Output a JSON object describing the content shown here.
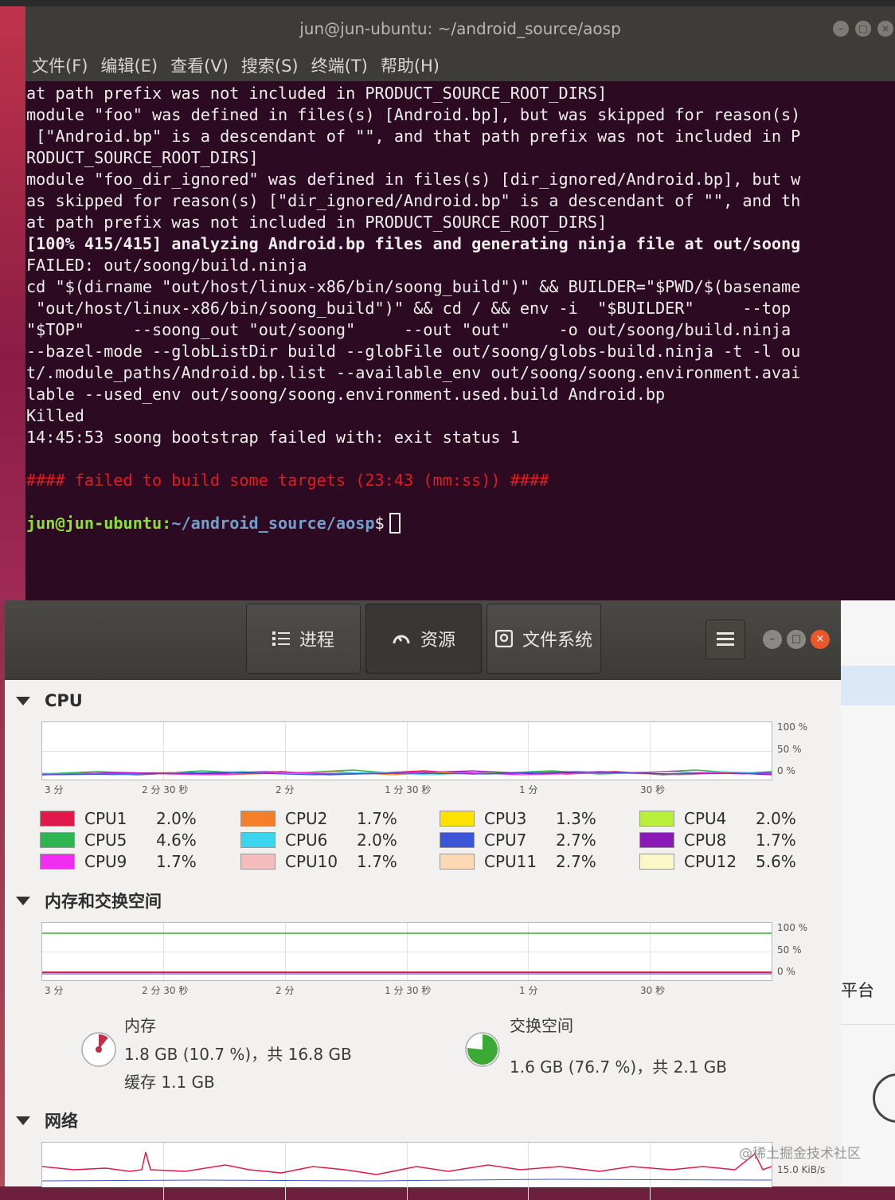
{
  "terminal": {
    "title": "jun@jun-ubuntu: ~/android_source/aosp",
    "menu": [
      "文件(F)",
      "编辑(E)",
      "查看(V)",
      "搜索(S)",
      "终端(T)",
      "帮助(H)"
    ],
    "lines": [
      "at path prefix was not included in PRODUCT_SOURCE_ROOT_DIRS]",
      "module \"foo\" was defined in files(s) [Android.bp], but was skipped for reason(s)",
      " [\"Android.bp\" is a descendant of \"\", and that path prefix was not included in P",
      "RODUCT_SOURCE_ROOT_DIRS]",
      "module \"foo_dir_ignored\" was defined in files(s) [dir_ignored/Android.bp], but w",
      "as skipped for reason(s) [\"dir_ignored/Android.bp\" is a descendant of \"\", and th",
      "at path prefix was not included in PRODUCT_SOURCE_ROOT_DIRS]",
      "[100% 415/415] analyzing Android.bp files and generating ninja file at out/soong",
      "FAILED: out/soong/build.ninja",
      "cd \"$(dirname \"out/host/linux-x86/bin/soong_build\")\" && BUILDER=\"$PWD/$(basename",
      " \"out/host/linux-x86/bin/soong_build\")\" && cd / && env -i  \"$BUILDER\"     --top",
      "\"$TOP\"     --soong_out \"out/soong\"     --out \"out\"     -o out/soong/build.ninja",
      "--bazel-mode --globListDir build --globFile out/soong/globs-build.ninja -t -l ou",
      "t/.module_paths/Android.bp.list --available_env out/soong/soong.environment.avai",
      "lable --used_env out/soong/soong.environment.used.build Android.bp",
      "Killed",
      "14:45:53 soong bootstrap failed with: exit status 1",
      "",
      "#### failed to build some targets (23:43 (mm:ss)) ####",
      ""
    ],
    "prompt_user": "jun@jun-ubuntu",
    "prompt_sep": ":",
    "prompt_path": "~/android_source/aosp",
    "prompt_symbol": "$"
  },
  "monitor": {
    "tabs": [
      {
        "label": "进程",
        "icon": "list-icon"
      },
      {
        "label": "资源",
        "icon": "gauge-icon"
      },
      {
        "label": "文件系统",
        "icon": "disk-icon"
      }
    ],
    "cpu_title": "CPU",
    "mem_title": "内存和交换空间",
    "net_title": "网络",
    "y_labels": [
      "100 %",
      "50 %",
      "0 %"
    ],
    "x_labels": [
      "3 分",
      "2 分 30 秒",
      "2 分",
      "1 分 30 秒",
      "1 分",
      "30 秒"
    ],
    "cpus": [
      {
        "name": "CPU1",
        "value": "2.0%",
        "color": "#e0194a"
      },
      {
        "name": "CPU2",
        "value": "1.7%",
        "color": "#f57e2a"
      },
      {
        "name": "CPU3",
        "value": "1.3%",
        "color": "#fce200"
      },
      {
        "name": "CPU4",
        "value": "2.0%",
        "color": "#b8f03c"
      },
      {
        "name": "CPU5",
        "value": "4.6%",
        "color": "#2db64f"
      },
      {
        "name": "CPU6",
        "value": "2.0%",
        "color": "#3cd5f0"
      },
      {
        "name": "CPU7",
        "value": "2.7%",
        "color": "#3a55d6"
      },
      {
        "name": "CPU8",
        "value": "1.7%",
        "color": "#8a1ab6"
      },
      {
        "name": "CPU9",
        "value": "1.7%",
        "color": "#f02ef0"
      },
      {
        "name": "CPU10",
        "value": "1.7%",
        "color": "#f5bcbc"
      },
      {
        "name": "CPU11",
        "value": "2.7%",
        "color": "#fcd8b4"
      },
      {
        "name": "CPU12",
        "value": "5.6%",
        "color": "#fbf8c8"
      }
    ],
    "memory": {
      "label": "内存",
      "value": "1.8 GB (10.7 %)，共 16.8 GB",
      "cache": "缓存 1.1 GB",
      "fraction": 0.107,
      "color": "#c0304a"
    },
    "swap": {
      "label": "交换空间",
      "value": "1.6 GB (76.7 %)，共 2.1 GB",
      "fraction": 0.767,
      "color": "#3aaa35"
    },
    "net_ylabel": "15.0 KiB/s"
  },
  "background_window": {
    "text": "平台"
  },
  "watermark": "@稀土掘金技术社区"
}
